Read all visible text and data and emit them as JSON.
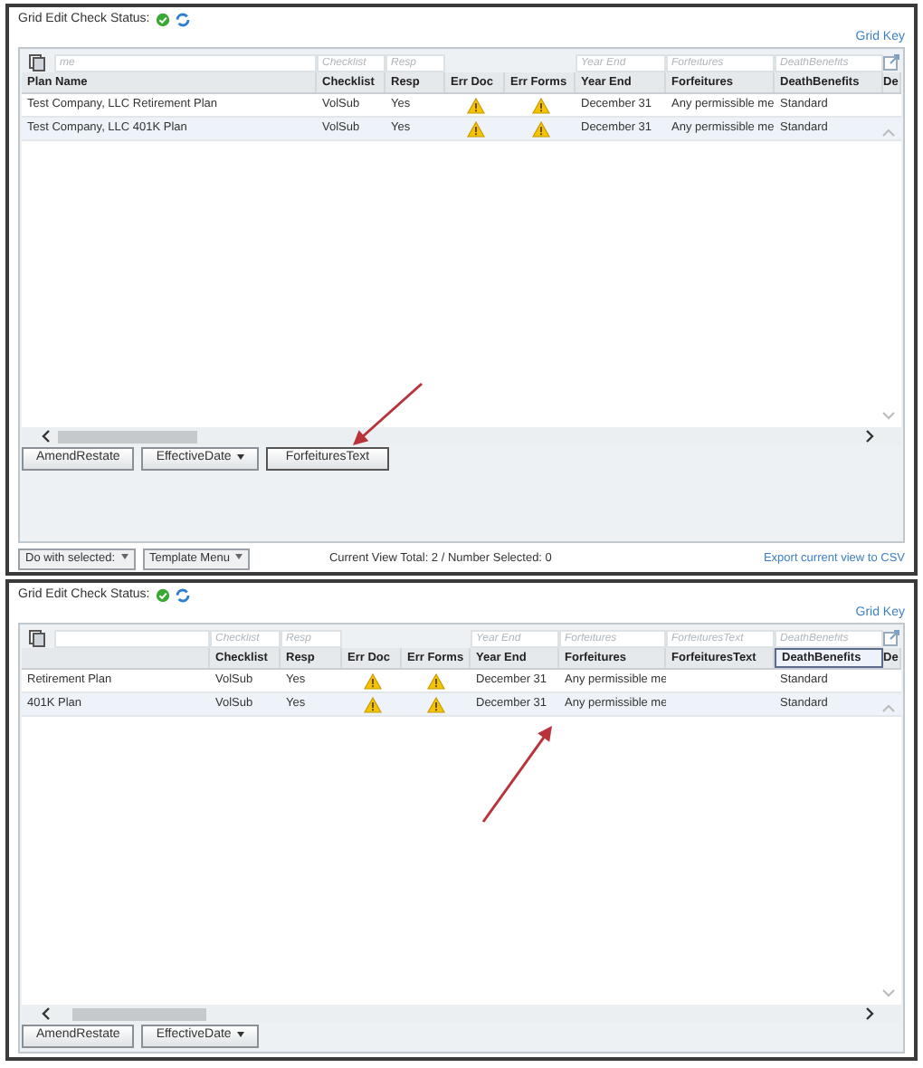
{
  "panels": [
    {
      "status_label": "Grid Edit Check Status:",
      "grid_key": "Grid Key",
      "columns": [
        {
          "header": "Plan Name",
          "placeholder": "me",
          "selected": false
        },
        {
          "header": "Checklist",
          "placeholder": "Checklist",
          "selected": false
        },
        {
          "header": "Resp",
          "placeholder": "Resp",
          "selected": false
        },
        {
          "header": "Err Doc",
          "selected": false
        },
        {
          "header": "Err Forms",
          "selected": false
        },
        {
          "header": "Year End",
          "placeholder": "Year End",
          "selected": false
        },
        {
          "header": "Forfeitures",
          "placeholder": "Forfeitures",
          "selected": false
        },
        {
          "header": "DeathBenefits",
          "placeholder": "DeathBenefits",
          "selected": false
        },
        {
          "header": "De",
          "selected": false
        }
      ],
      "rows": [
        [
          {
            "kind": "text",
            "text": "Test Company, LLC Retirement Plan"
          },
          {
            "kind": "text",
            "text": "VolSub"
          },
          {
            "kind": "text",
            "text": "Yes"
          },
          {
            "kind": "warning"
          },
          {
            "kind": "warning"
          },
          {
            "kind": "text",
            "text": "December 31"
          },
          {
            "kind": "text",
            "text": "Any permissible me"
          },
          {
            "kind": "text",
            "text": "Standard"
          }
        ],
        [
          {
            "kind": "text",
            "text": "Test Company, LLC 401K Plan"
          },
          {
            "kind": "text",
            "text": "VolSub"
          },
          {
            "kind": "text",
            "text": "Yes"
          },
          {
            "kind": "warning"
          },
          {
            "kind": "warning"
          },
          {
            "kind": "text",
            "text": "December 31"
          },
          {
            "kind": "text",
            "text": "Any permissible me"
          },
          {
            "kind": "text",
            "text": "Standard"
          }
        ]
      ],
      "buttons": [
        {
          "label": "AmendRestate",
          "dropdown": false
        },
        {
          "label": "EffectiveDate",
          "dropdown": true
        },
        {
          "label": "ForfeituresText",
          "dropdown": false
        }
      ],
      "footer": {
        "menus": [
          "Do with selected:",
          "Template Menu"
        ],
        "summary": "Current View Total: 2 / Number Selected: 0",
        "export_link": "Export current view to CSV"
      },
      "arrow": {
        "kind": "down-left"
      }
    },
    {
      "status_label": "Grid Edit Check Status:",
      "grid_key": "Grid Key",
      "columns": [
        {
          "selected": false
        },
        {
          "header": "Checklist",
          "placeholder": "Checklist",
          "selected": false
        },
        {
          "header": "Resp",
          "placeholder": "Resp",
          "selected": false
        },
        {
          "header": "Err Doc",
          "selected": false
        },
        {
          "header": "Err Forms",
          "selected": false
        },
        {
          "header": "Year End",
          "placeholder": "Year End",
          "selected": false
        },
        {
          "header": "Forfeitures",
          "placeholder": "Forfeitures",
          "selected": false
        },
        {
          "header": "ForfeituresText",
          "placeholder": "ForfeituresText",
          "selected": false
        },
        {
          "header": "DeathBenefits",
          "placeholder": "DeathBenefits",
          "selected": true
        },
        {
          "header": "De",
          "selected": false
        }
      ],
      "rows": [
        [
          {
            "kind": "text",
            "text": "Retirement Plan"
          },
          {
            "kind": "text",
            "text": "VolSub"
          },
          {
            "kind": "text",
            "text": "Yes"
          },
          {
            "kind": "warning"
          },
          {
            "kind": "warning"
          },
          {
            "kind": "text",
            "text": "December 31"
          },
          {
            "kind": "text",
            "text": "Any permissible me"
          },
          {
            "kind": "empty"
          },
          {
            "kind": "text",
            "text": "Standard"
          }
        ],
        [
          {
            "kind": "text",
            "text": "401K Plan"
          },
          {
            "kind": "text",
            "text": "VolSub"
          },
          {
            "kind": "text",
            "text": "Yes"
          },
          {
            "kind": "warning"
          },
          {
            "kind": "warning"
          },
          {
            "kind": "text",
            "text": "December 31"
          },
          {
            "kind": "text",
            "text": "Any permissible me"
          },
          {
            "kind": "empty"
          },
          {
            "kind": "text",
            "text": "Standard"
          }
        ]
      ],
      "buttons": [
        {
          "label": "AmendRestate",
          "dropdown": false
        },
        {
          "label": "EffectiveDate",
          "dropdown": true
        }
      ],
      "arrow": {
        "kind": "up-right"
      }
    }
  ]
}
